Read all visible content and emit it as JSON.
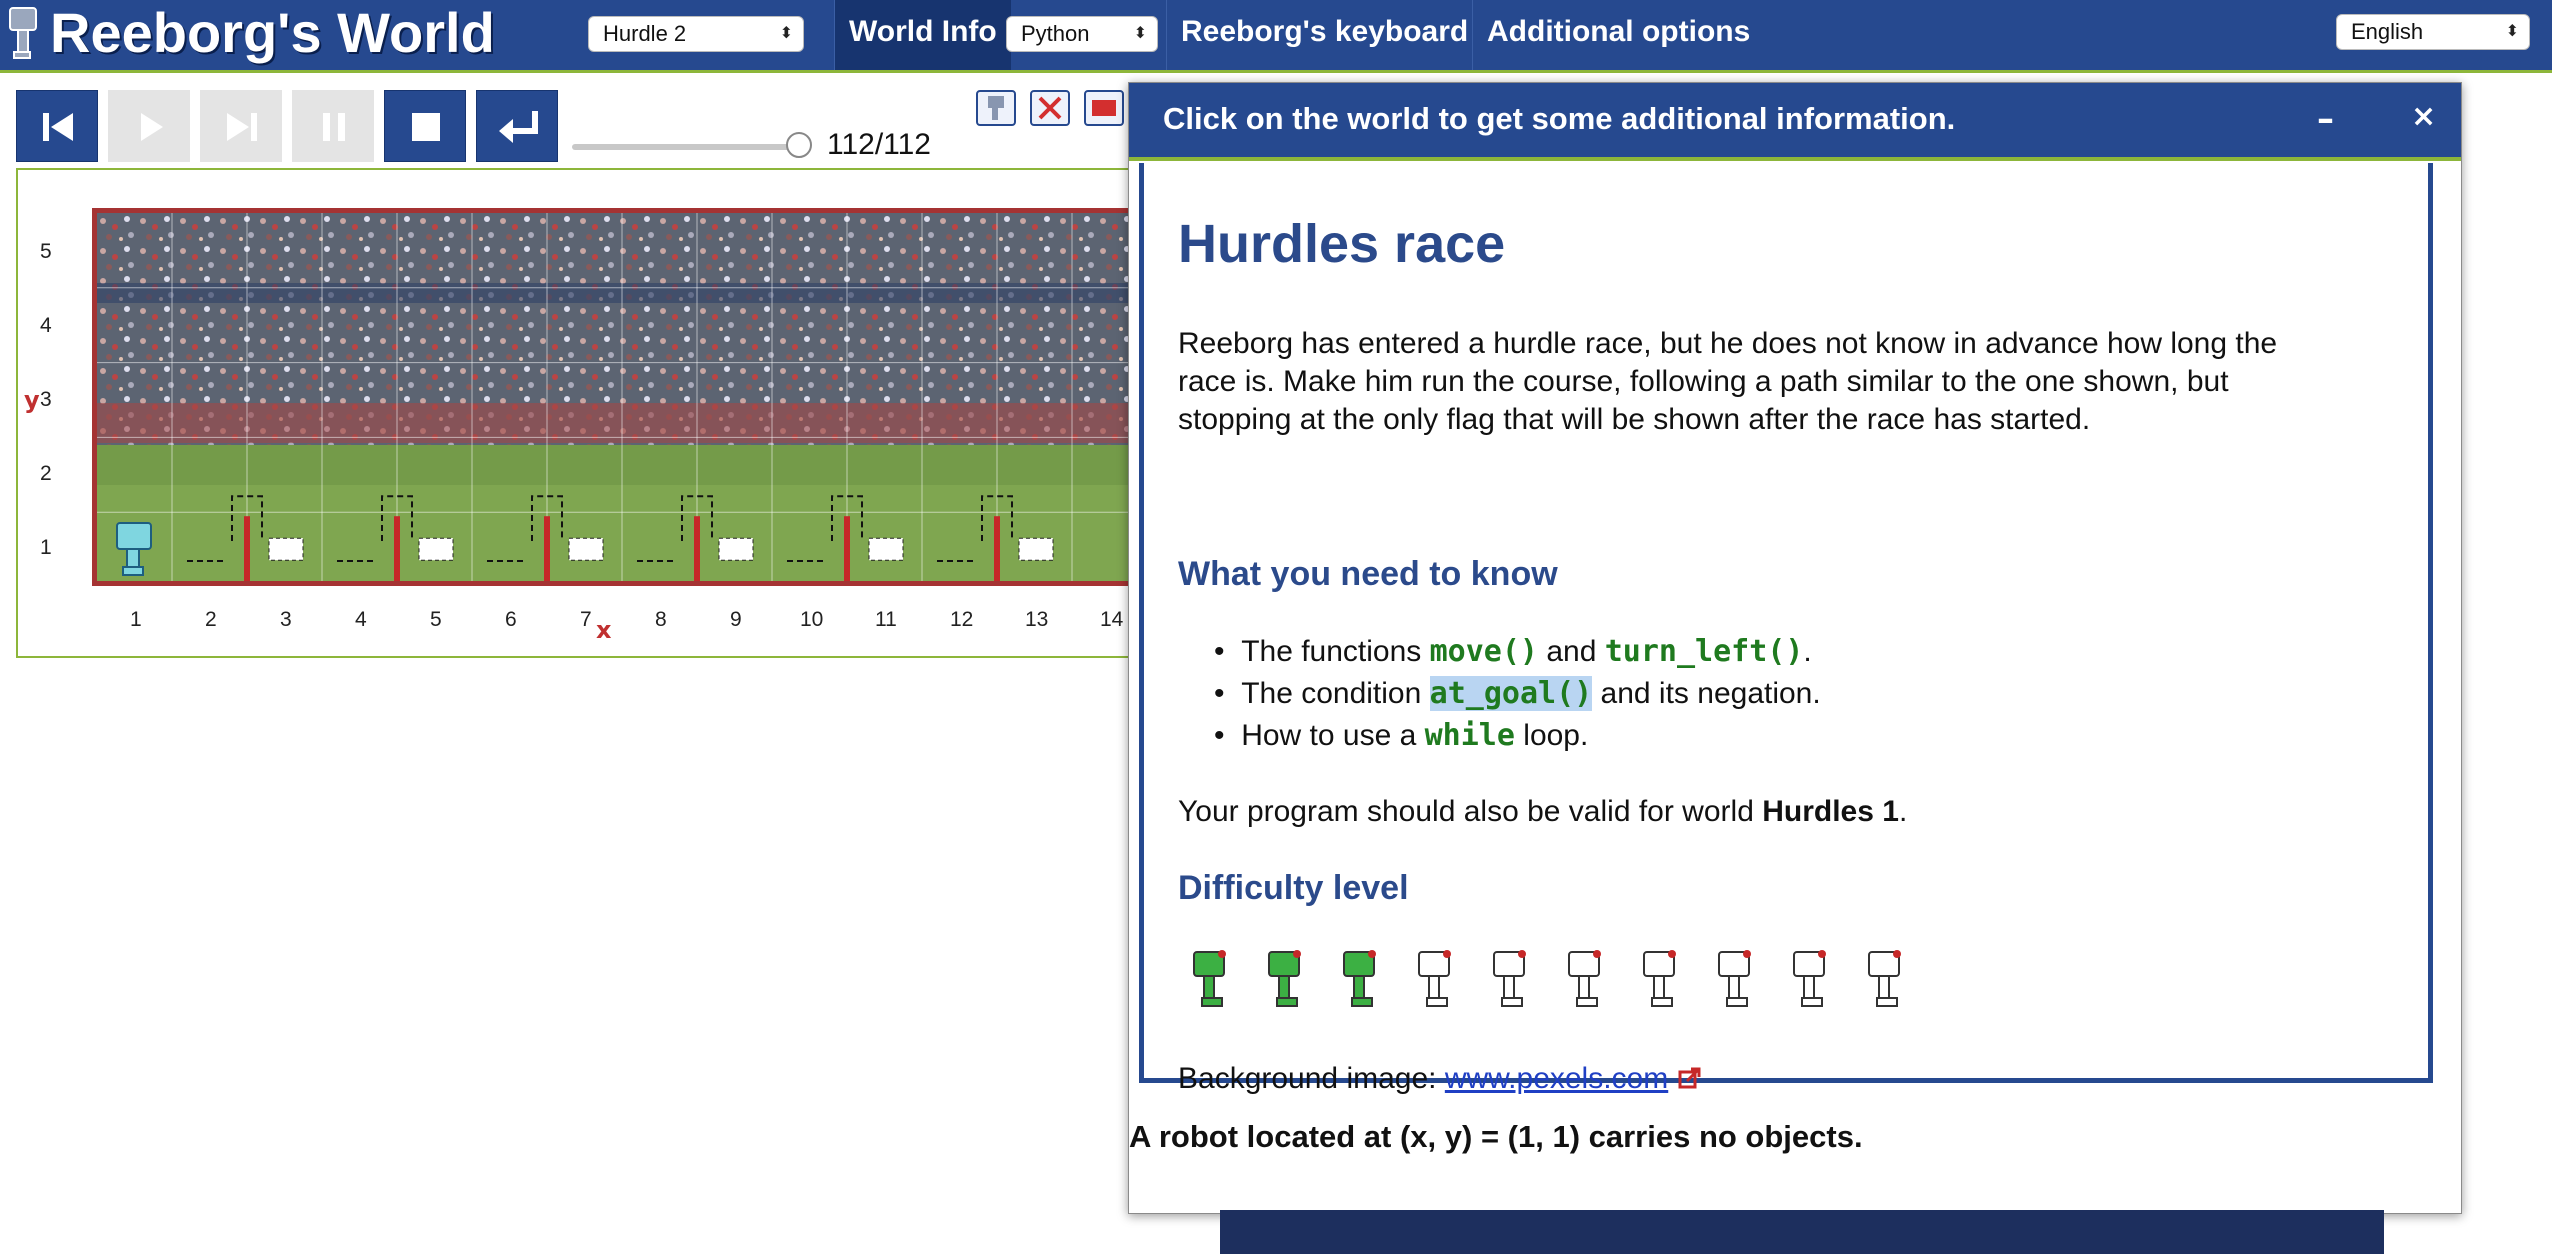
{
  "header": {
    "app_title": "Reeborg's World",
    "world_select": "Hurdle 2",
    "tab_world_info": "World Info",
    "language_select": "Python",
    "tab_keyboard": "Reeborg's keyboard",
    "tab_additional": "Additional options",
    "ui_language_select": "English"
  },
  "toolbar": {
    "step_count": "112/112",
    "progress_fraction": 1.0
  },
  "world": {
    "y_ticks": [
      "5",
      "4",
      "3",
      "2",
      "1"
    ],
    "y_axis_letter": "y",
    "x_ticks": [
      "1",
      "2",
      "3",
      "4",
      "5",
      "6",
      "7",
      "8",
      "9",
      "10",
      "11",
      "12",
      "13",
      "14"
    ],
    "x_axis_letter": "x"
  },
  "dialog": {
    "title": "Click on the world to get some additional information.",
    "minimize": "–",
    "close": "×",
    "heading": "Hurdles race",
    "intro_line1": "Reeborg has entered a hurdle race, but he does not know in advance how long the",
    "intro_line2": "race is. Make him run the course, following a path similar to the one shown, but",
    "intro_line3": "stopping at the only flag that will be shown after the race has started.",
    "need_heading": "What you need to know",
    "b1_pre": "The functions ",
    "b1_code1": "move()",
    "b1_mid": " and ",
    "b1_code2": "turn_left()",
    "b1_post": ".",
    "b2_pre": "The condition ",
    "b2_code": "at_goal()",
    "b2_post": " and its negation.",
    "b3_pre": "How to use a ",
    "b3_code": "while",
    "b3_post": " loop.",
    "valid_pre": "Your program should also be valid for world ",
    "valid_bold": "Hurdles 1",
    "valid_post": ".",
    "difficulty_heading": "Difficulty level",
    "difficulty_value": 3,
    "difficulty_max": 10,
    "bg_label": "Background image: ",
    "bg_link": "www.pexels.com",
    "robot_note": "A robot located at (x, y) = (1, 1) carries no objects."
  },
  "colors": {
    "header_blue": "#26498f",
    "accent_green": "#8db63a",
    "hurdle_red": "#c62828",
    "code_green": "#1f7a1f"
  },
  "icons": [
    "reeborg-robot-icon",
    "first-step-icon",
    "play-icon",
    "step-icon",
    "pause-icon",
    "stop-icon",
    "reload-icon",
    "external-link-icon"
  ]
}
